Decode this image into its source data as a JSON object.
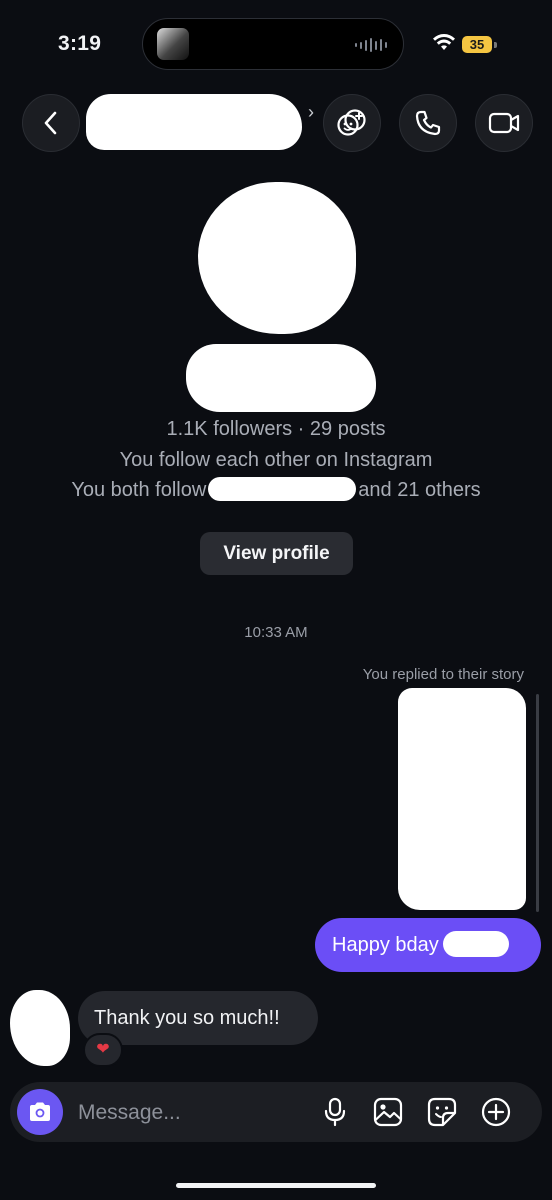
{
  "status_bar": {
    "time": "3:19",
    "battery": "35"
  },
  "header": {
    "back_icon": "chevron-left-icon",
    "effects_icon": "effects-icon",
    "call_icon": "phone-icon",
    "video_icon": "video-camera-icon"
  },
  "profile": {
    "stats": "1.1K followers · 29 posts",
    "follow_status": "You follow each other on Instagram",
    "mutual_prefix": "You both follow",
    "mutual_suffix": "and 21 others",
    "view_profile_label": "View profile"
  },
  "messages": {
    "timestamp": "10:33 AM",
    "story_note": "You replied to their story",
    "outgoing": "Happy bday",
    "incoming": "Thank you so much!!",
    "reaction": "❤"
  },
  "composer": {
    "placeholder": "Message..."
  },
  "colors": {
    "accent": "#6b4ef6",
    "background": "#0b0d12",
    "bubble_in": "#25272d"
  }
}
